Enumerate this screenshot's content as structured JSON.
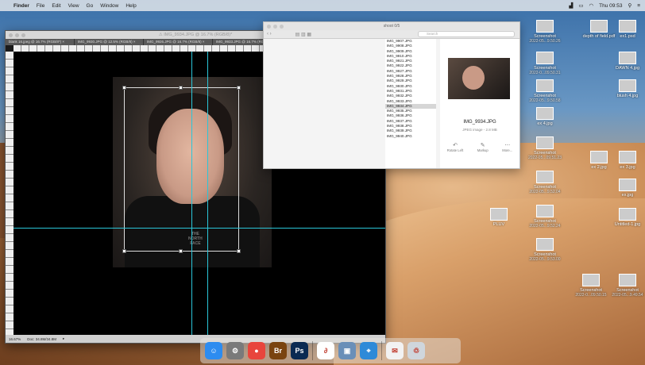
{
  "menubar": {
    "app": "Finder",
    "items": [
      "File",
      "Edit",
      "View",
      "Go",
      "Window",
      "Help"
    ],
    "clock": "Thu 09:53"
  },
  "photoshop": {
    "title": "⚠ IMG_9934.JPG @ 16.7% (RGB/8)*",
    "tabs": [
      "blank 16.jpeg @ 16.7% (RGB/8*) ×",
      "IMG_9930.JPG @ 12.5% (RGB/8) ×",
      "IMG_9926.JPG @ 16.7% (RGB/8) ×",
      "IMG_9933.JPG @ 16.7% (RGB/8) ×",
      "IMG_9934.JPG @ 16.7% (RGB/8) ×"
    ],
    "photo_text": "THE\nNORTH\nFACE",
    "status_zoom": "16.67%",
    "status_doc": "Doc: 34.8M/34.8M"
  },
  "finder": {
    "title": "shoot 0/5",
    "search_placeholder": "Search",
    "files": [
      "IMG_9907.JPG",
      "IMG_9908.JPG",
      "IMG_9909.JPG",
      "IMG_9910.JPG",
      "IMG_9921.JPG",
      "IMG_9922.JPG",
      "IMG_9927.JPG",
      "IMG_9928.JPG",
      "IMG_9929.JPG",
      "IMG_9930.JPG",
      "IMG_9931.JPG",
      "IMG_9932.JPG",
      "IMG_9933.JPG",
      "IMG_9934.JPG",
      "IMG_9935.JPG",
      "IMG_9936.JPG",
      "IMG_9937.JPG",
      "IMG_9938.JPG",
      "IMG_9939.JPG",
      "IMG_9940.JPG"
    ],
    "selected": "IMG_9934.JPG",
    "preview_name": "IMG_9934.JPG",
    "preview_kind": "JPEG image - 2.8 MB",
    "actions": [
      "Rotate Left",
      "Markup",
      "More..."
    ]
  },
  "desktop": [
    {
      "label": "Screenshot",
      "sub": "2022-05...9.50.26"
    },
    {
      "label": "depth of field.pdf",
      "sub": ""
    },
    {
      "label": "ex1.psd",
      "sub": ""
    },
    {
      "label": "Screenshot",
      "sub": "2022-0...09.50.31"
    },
    {
      "label": "DAWN 4.jpg",
      "sub": ""
    },
    {
      "label": "Screenshot",
      "sub": "2022-05...9.50.58"
    },
    {
      "label": "blush 4.jpg",
      "sub": ""
    },
    {
      "label": "ex 4.jpg",
      "sub": ""
    },
    {
      "label": "Screenshot",
      "sub": "2022-05...09.51.23"
    },
    {
      "label": "ex 2.jpg",
      "sub": ""
    },
    {
      "label": "ex 3.jpg",
      "sub": ""
    },
    {
      "label": "Screenshot",
      "sub": "2022-05...9.52.04"
    },
    {
      "label": "ex.jpg",
      "sub": ""
    },
    {
      "label": "PLUV",
      "sub": ""
    },
    {
      "label": "Screenshot",
      "sub": "2022-05...9.52.24"
    },
    {
      "label": "Untitled-1.jpg",
      "sub": ""
    },
    {
      "label": "Screenshot",
      "sub": "2022-05...9.53.00"
    },
    {
      "label": "Screenshot",
      "sub": "2022-0...09.50.15"
    },
    {
      "label": "Screenshot",
      "sub": "2022-05...9.49.54"
    }
  ],
  "dock": [
    {
      "name": "Finder",
      "glyph": "☺",
      "color": "#2d8cf0"
    },
    {
      "name": "System Preferences",
      "glyph": "⚙",
      "color": "#7a7a7a"
    },
    {
      "name": "Chrome",
      "glyph": "●",
      "color": "#e8453c"
    },
    {
      "name": "Bridge",
      "glyph": "Br",
      "color": "#7a4410"
    },
    {
      "name": "Photoshop",
      "glyph": "Ps",
      "color": "#0a2a52"
    },
    {
      "name": "Acrobat",
      "glyph": "∂",
      "color": "#ffffff"
    },
    {
      "name": "Preview",
      "glyph": "▣",
      "color": "#6a8fb8"
    },
    {
      "name": "Safari",
      "glyph": "⌖",
      "color": "#2e8ad8"
    },
    {
      "name": "Mail",
      "glyph": "✉",
      "color": "#f2f2f2"
    },
    {
      "name": "Trash",
      "glyph": "♲",
      "color": "#cfd6dc"
    }
  ]
}
